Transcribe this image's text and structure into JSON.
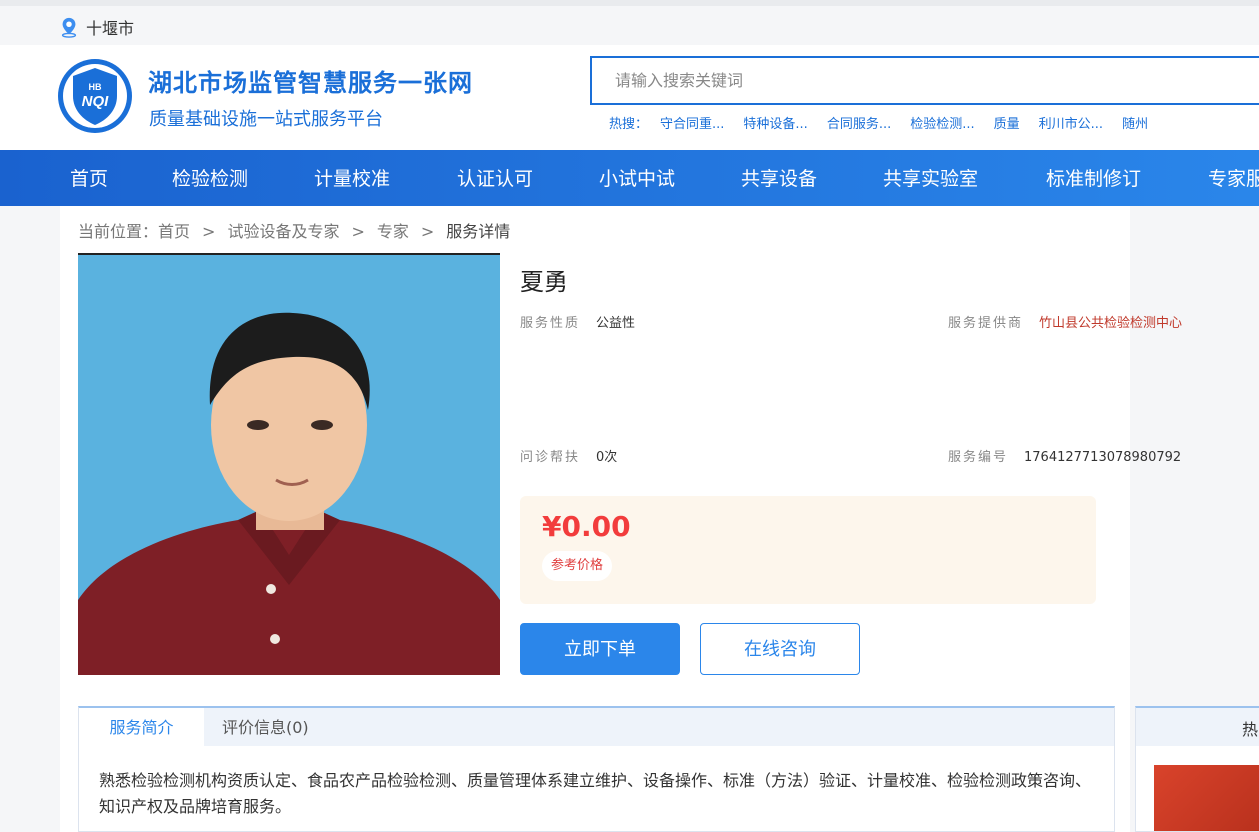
{
  "city": {
    "name": "十堰市"
  },
  "brand": {
    "logo_text_top": "HB",
    "logo_text_main": "NQI",
    "title": "湖北市场监管智慧服务一张网",
    "subtitle": "质量基础设施一站式服务平台"
  },
  "search": {
    "placeholder": "请输入搜索关键词",
    "hot_label": "热搜：",
    "hot_items": [
      "守合同重...",
      "特种设备...",
      "合同服务...",
      "检验检测...",
      "质量",
      "利川市公...",
      "随州"
    ]
  },
  "nav": {
    "items": [
      "首页",
      "检验检测",
      "计量校准",
      "认证认可",
      "小试中试",
      "共享设备",
      "共享实验室",
      "标准制修订",
      "专家服"
    ]
  },
  "breadcrumb": {
    "prefix": "当前位置：",
    "items": [
      "首页",
      "试验设备及专家",
      "专家",
      "服务详情"
    ],
    "separator": ">"
  },
  "expert": {
    "name": "夏勇",
    "service_type_label": "服务性质",
    "service_type_value": "公益性",
    "provider_label": "服务提供商",
    "provider_value": "竹山县公共检验检测中心",
    "consult_label": "问诊帮扶",
    "consult_value": "0次",
    "service_no_label": "服务编号",
    "service_no_value": "1764127713078980792"
  },
  "price": {
    "value": "¥0.00",
    "tag": "参考价格"
  },
  "actions": {
    "order": "立即下单",
    "consult": "在线咨询"
  },
  "tabs": {
    "items": [
      "服务简介",
      "评价信息(0)"
    ],
    "active": 0,
    "description": "熟悉检验检测机构资质认定、食品农产品检验检测、质量管理体系建立维护、设备操作、标准（方法）验证、计量校准、检验检测政策咨询、知识产权及品牌培育服务。"
  },
  "side": {
    "title": "热"
  },
  "colors": {
    "brand_blue": "#1a6fd8",
    "button_blue": "#2b86ea",
    "price_red": "#f23c3c",
    "provider_red": "#c0392b",
    "price_bg": "#fdf6ec"
  }
}
